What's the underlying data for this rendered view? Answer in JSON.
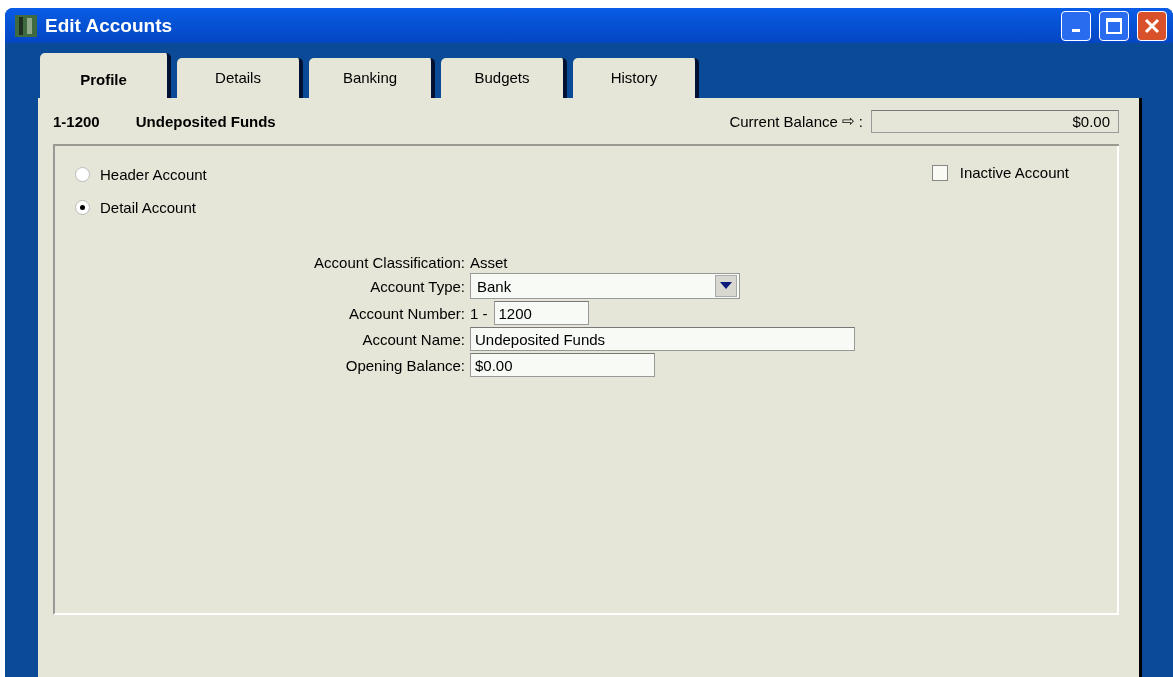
{
  "window": {
    "title": "Edit Accounts"
  },
  "tabs": [
    {
      "label": "Profile",
      "selected": true
    },
    {
      "label": "Details",
      "selected": false
    },
    {
      "label": "Banking",
      "selected": false
    },
    {
      "label": "Budgets",
      "selected": false
    },
    {
      "label": "History",
      "selected": false
    }
  ],
  "header": {
    "account_number": "1-1200",
    "account_name": "Undeposited Funds",
    "balance_label": "Current Balance",
    "balance_arrow": "⇨",
    "balance_colon": ":",
    "balance_value": "$0.00"
  },
  "account_kind": [
    {
      "label": "Header Account",
      "selected": false
    },
    {
      "label": "Detail Account",
      "selected": true
    }
  ],
  "inactive": {
    "label": "Inactive Account",
    "checked": false
  },
  "fields": [
    {
      "kind": "text",
      "label": "Account Classification:",
      "value": "Asset"
    },
    {
      "kind": "dropdown",
      "label": "Account Type:",
      "value": "Bank"
    },
    {
      "kind": "number",
      "label": "Account Number:",
      "prefix": "1 -",
      "value": "1200"
    },
    {
      "kind": "input",
      "label": "Account Name:",
      "value": "Undeposited Funds"
    },
    {
      "kind": "input-short",
      "label": "Opening Balance:",
      "value": "$0.00"
    }
  ]
}
